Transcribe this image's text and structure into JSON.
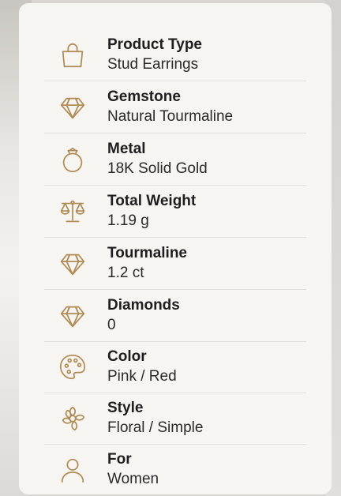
{
  "specs": [
    {
      "label": "Product Type",
      "value": "Stud Earrings",
      "icon": "shopping-bag-icon"
    },
    {
      "label": "Gemstone",
      "value": "Natural Tourmaline",
      "icon": "diamond-icon"
    },
    {
      "label": "Metal",
      "value": "18K Solid Gold",
      "icon": "ring-icon"
    },
    {
      "label": "Total Weight",
      "value": "1.19 g",
      "icon": "scale-icon"
    },
    {
      "label": "Tourmaline",
      "value": "1.2 ct",
      "icon": "diamond-icon"
    },
    {
      "label": "Diamonds",
      "value": "0",
      "icon": "diamond-icon"
    },
    {
      "label": "Color",
      "value": "Pink / Red",
      "icon": "palette-icon"
    },
    {
      "label": "Style",
      "value": "Floral / Simple",
      "icon": "flower-icon"
    },
    {
      "label": "For",
      "value": "Women",
      "icon": "person-icon"
    }
  ],
  "colors": {
    "accent": "#b08a54",
    "card": "#f7f5f1",
    "divider": "#e2ded8"
  }
}
